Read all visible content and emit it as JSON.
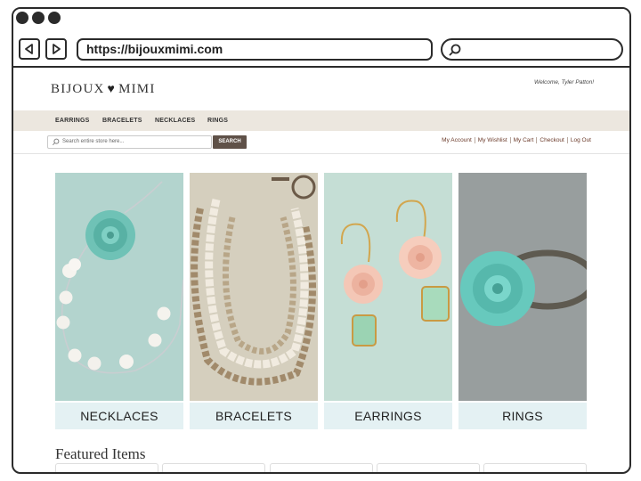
{
  "browser": {
    "url": "https://bijouxmimi.com"
  },
  "site": {
    "logo_left": "BIJOUX",
    "logo_right": "MIMI",
    "welcome": "Welcome, Tyler Patton!",
    "nav": [
      "EARRINGS",
      "BRACELETS",
      "NECKLACES",
      "RINGS"
    ],
    "search_placeholder": "Search entire store here...",
    "search_button": "SEARCH",
    "account_links": [
      "My Account",
      "My Wishlist",
      "My Cart",
      "Checkout",
      "Log Out"
    ],
    "categories": [
      {
        "label": "NECKLACES",
        "icon": "necklace-photo"
      },
      {
        "label": "BRACELETS",
        "icon": "bracelet-photo"
      },
      {
        "label": "EARRINGS",
        "icon": "earrings-photo"
      },
      {
        "label": "RINGS",
        "icon": "ring-photo"
      }
    ],
    "featured_title": "Featured Items"
  },
  "colors": {
    "nav_bg": "#ece7df",
    "search_button_bg": "#5f5148",
    "link": "#6b3a2a",
    "category_label_bg": "#e4f1f3",
    "accent_mint": "#67c9bd"
  }
}
